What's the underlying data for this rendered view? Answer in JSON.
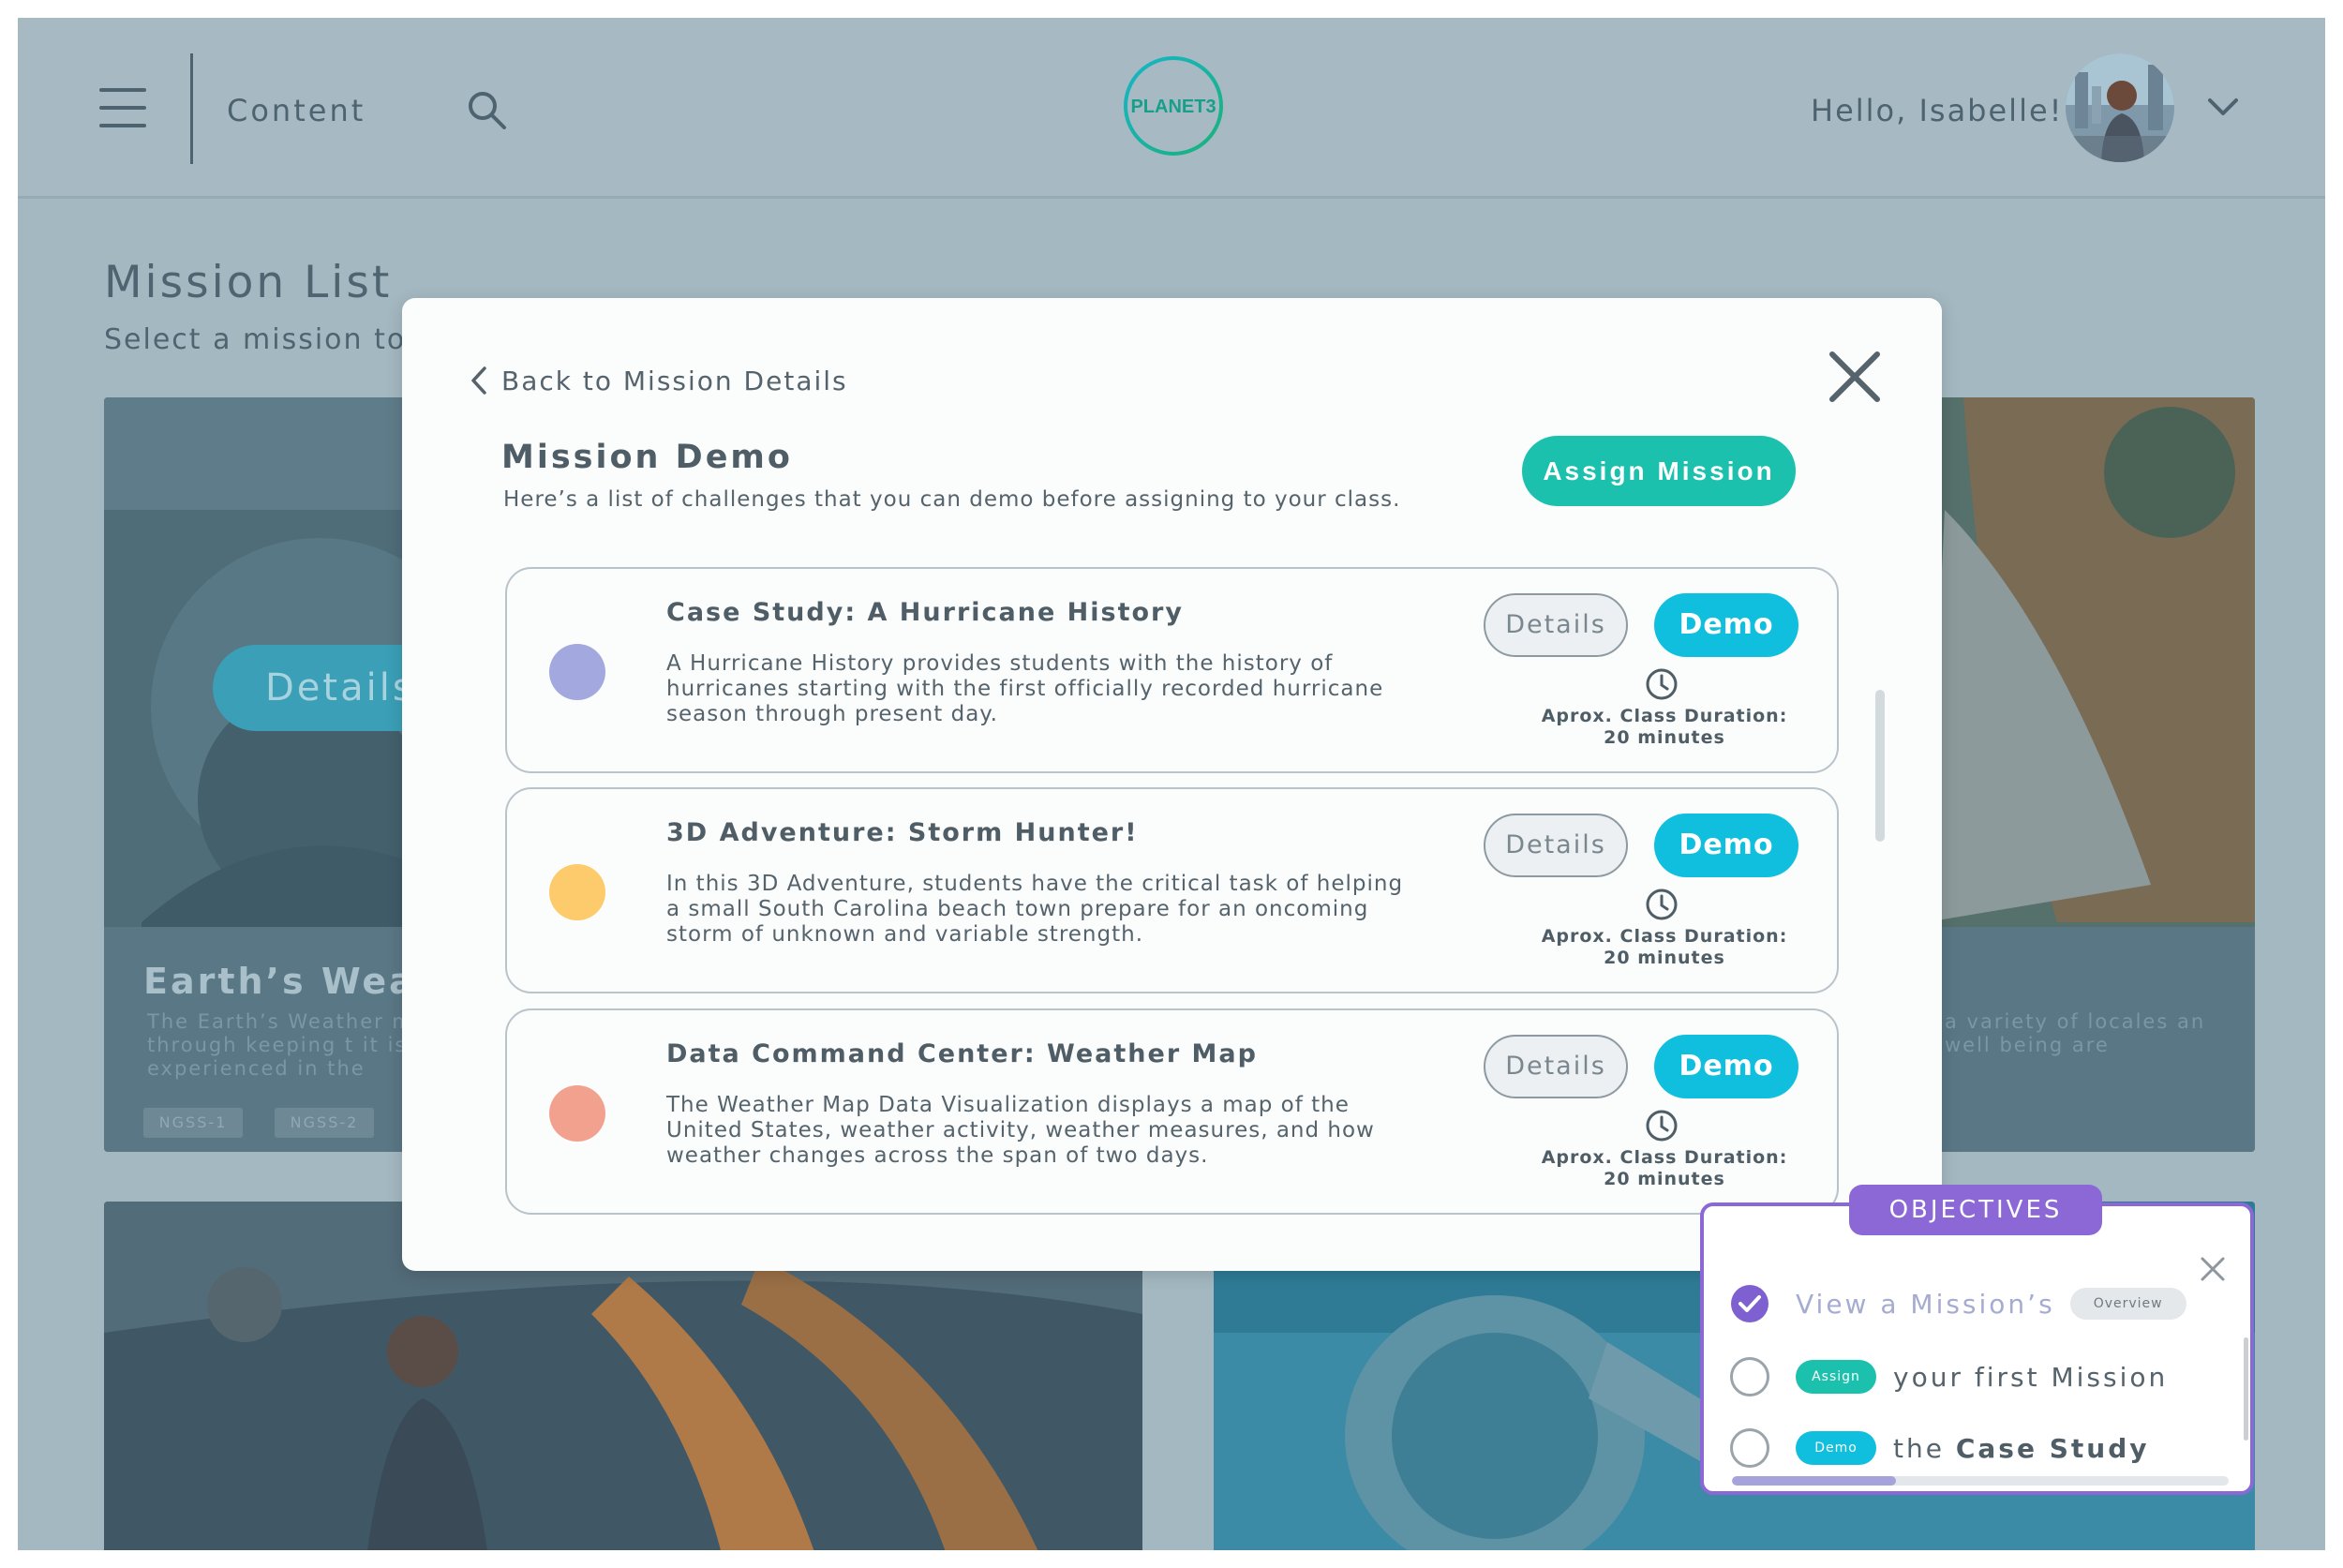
{
  "header": {
    "nav_label": "Content",
    "logo_text": "PLANET3",
    "greeting": "Hello, Isabelle!"
  },
  "page": {
    "title": "Mission List",
    "subtitle": "Select a mission to"
  },
  "cards": [
    {
      "details_label": "Details",
      "title": "Earth’s Weat",
      "description": "The Earth’s Weather mi part through keeping t it is experienced in the",
      "tags": [
        "NGSS-1",
        "NGSS-2"
      ]
    },
    {
      "description": "a variety of locales an well being are"
    }
  ],
  "modal": {
    "back_label": "Back to Mission Details",
    "title": "Mission Demo",
    "subtitle": "Here’s a list of challenges that you can demo before assigning to your class.",
    "assign_label": "Assign Mission",
    "missions": [
      {
        "title": "Case Study: A Hurricane History",
        "description": "A Hurricane History provides students with the history of hurricanes starting with the first officially recorded hurricane season through present day.",
        "details_label": "Details",
        "demo_label": "Demo",
        "duration_label": "Aprox. Class Duration:",
        "duration_value": "20 minutes",
        "dot_color": "#a3a8de"
      },
      {
        "title": "3D Adventure: Storm Hunter!",
        "description": "In this 3D Adventure, students have the critical task of helping a small South Carolina beach town prepare for an oncoming storm of unknown and variable strength.",
        "details_label": "Details",
        "demo_label": "Demo",
        "duration_label": "Aprox. Class Duration:",
        "duration_value": "20 minutes",
        "dot_color": "#fdcb6c"
      },
      {
        "title": "Data Command Center: Weather Map",
        "description": "The Weather Map Data Visualization displays a map of the United States, weather activity, weather measures, and how weather changes across the span of two days.",
        "details_label": "Details",
        "demo_label": "Demo",
        "duration_label": "Aprox. Class Duration:",
        "duration_value": "20 minutes",
        "dot_color": "#f2a18f"
      }
    ]
  },
  "objectives": {
    "title": "OBJECTIVES",
    "items": [
      {
        "text": "View a Mission’s",
        "chip": "Overview",
        "done": true
      },
      {
        "chip": "Assign",
        "text": "your first Mission",
        "done": false
      },
      {
        "chip": "Demo",
        "text_prefix": "the",
        "text_bold": "Case Study",
        "done": false
      }
    ],
    "progress": 0.33
  },
  "colors": {
    "accent_teal": "#1cc1ae",
    "demo_blue": "#10bfdd",
    "objectives_purple": "#8c68d6"
  },
  "icons": [
    "menu-icon",
    "search-icon",
    "chevron-down-icon",
    "chevron-left-icon",
    "close-icon",
    "clock-icon",
    "check-circle-icon"
  ]
}
